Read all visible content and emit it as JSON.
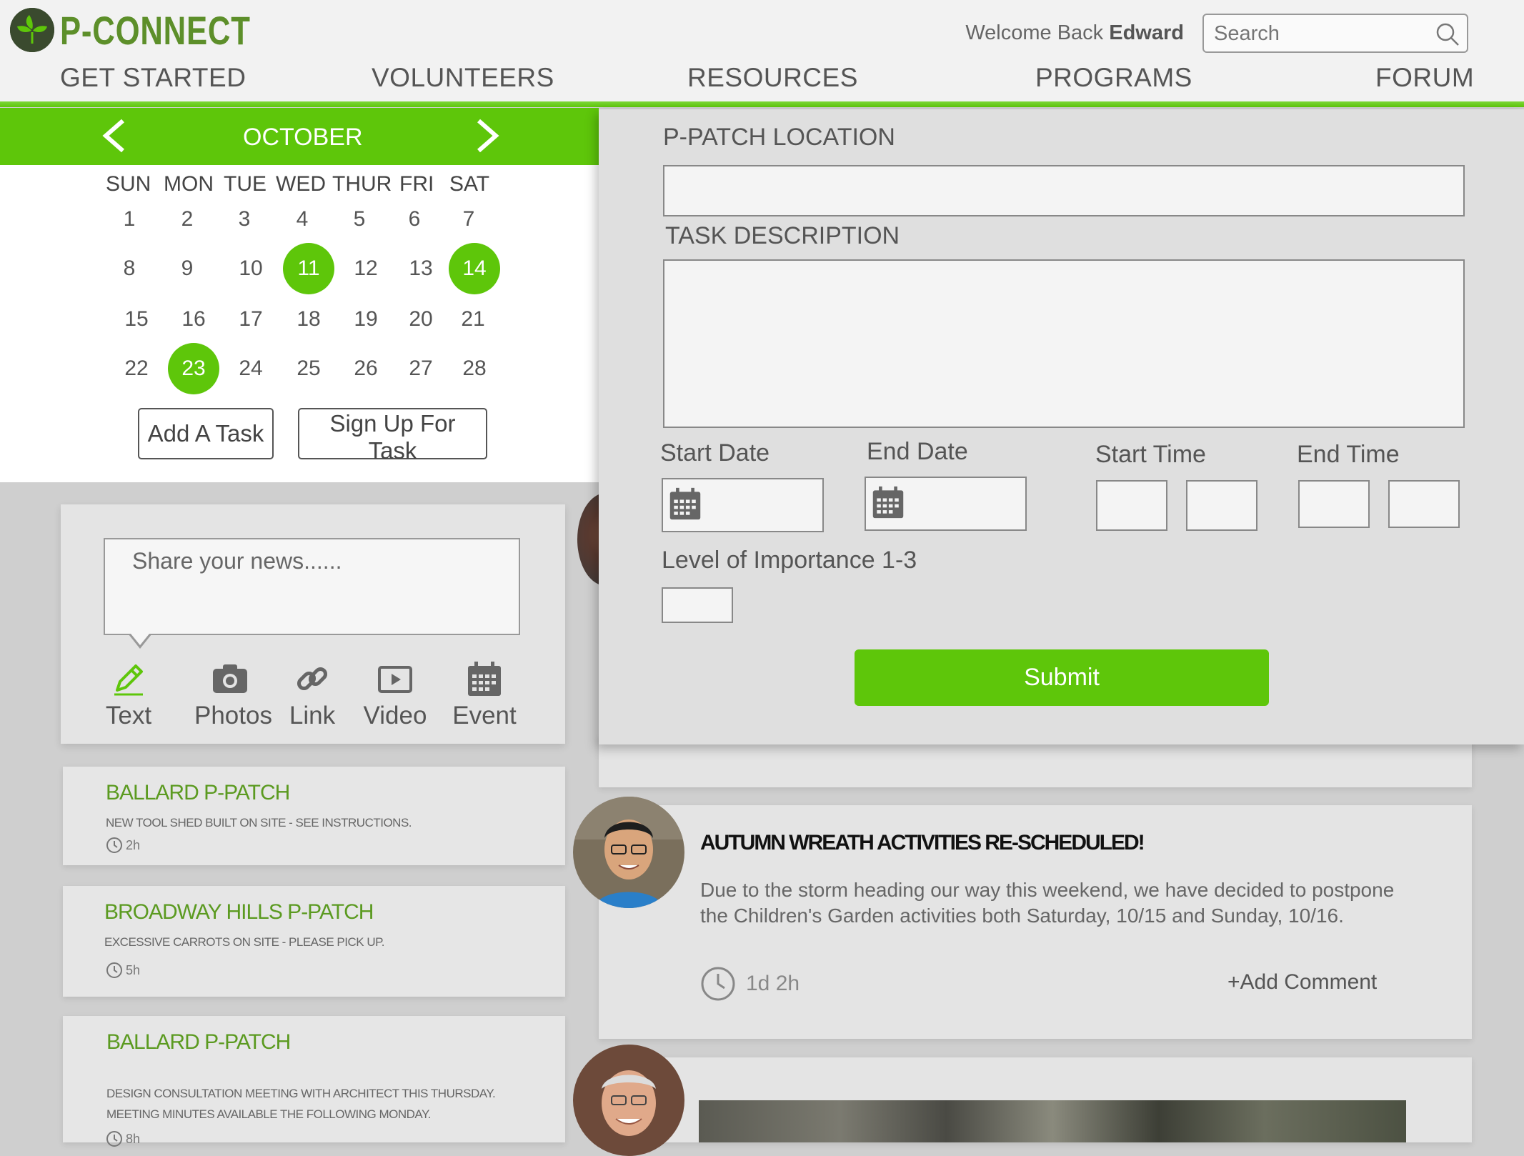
{
  "app": {
    "logo_text": "P-CONNECT"
  },
  "header": {
    "welcome_prefix": "Welcome Back",
    "user_name": "Edward",
    "search_placeholder": "Search",
    "nav": [
      "GET STARTED",
      "VOLUNTEERS",
      "RESOURCES",
      "PROGRAMS",
      "FORUM"
    ]
  },
  "calendar": {
    "month": "OCTOBER",
    "weekdays": [
      "SUN",
      "MON",
      "TUE",
      "WED",
      "THUR",
      "FRI",
      "SAT"
    ],
    "days": [
      "1",
      "2",
      "3",
      "4",
      "5",
      "6",
      "7",
      "8",
      "9",
      "10",
      "11",
      "12",
      "13",
      "14",
      "15",
      "16",
      "17",
      "18",
      "19",
      "20",
      "21",
      "22",
      "23",
      "24",
      "25",
      "26",
      "27",
      "28"
    ],
    "highlighted": [
      "11",
      "14",
      "23"
    ],
    "add_task_label": "Add A Task",
    "sign_up_label": "Sign Up For Task"
  },
  "share": {
    "placeholder": "Share your news......",
    "post_types": [
      "Text",
      "Photos",
      "Link",
      "Video",
      "Event"
    ]
  },
  "feed_left": [
    {
      "title": "BALLARD P-PATCH",
      "text": "NEW TOOL SHED BUILT ON SITE - SEE INSTRUCTIONS.",
      "time": "2h"
    },
    {
      "title": "BROADWAY HILLS P-PATCH",
      "text": "EXCESSIVE CARROTS ON SITE - PLEASE PICK UP.",
      "time": "5h"
    },
    {
      "title": "BALLARD P-PATCH",
      "text": "DESIGN CONSULTATION MEETING WITH ARCHITECT THIS THURSDAY. MEETING MINUTES AVAILABLE THE FOLLOWING MONDAY.",
      "time": "8h"
    }
  ],
  "post": {
    "title": "AUTUMN WREATH ACTIVITIES RE-SCHEDULED!",
    "body": "Due to the storm heading our way this weekend, we have decided to postpone the Children's Garden activities both Saturday, 10/15 and Sunday, 10/16.",
    "time": "1d 2h",
    "add_comment": "+Add Comment"
  },
  "task_form": {
    "location_label": "P-PATCH LOCATION",
    "description_label": "TASK DESCRIPTION",
    "start_date_label": "Start Date",
    "end_date_label": "End Date",
    "start_time_label": "Start Time",
    "end_time_label": "End Time",
    "importance_label": "Level of Importance 1-3",
    "submit_label": "Submit"
  },
  "colors": {
    "accent": "#5ec60a",
    "title_green": "#5b9a20",
    "logo_dark": "#3a4a2e"
  }
}
